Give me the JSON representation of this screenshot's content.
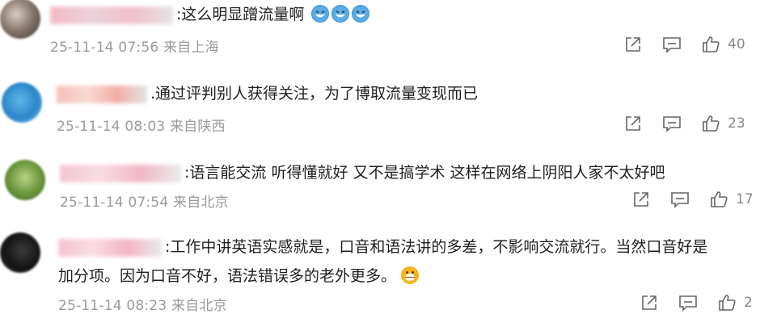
{
  "comments": [
    {
      "text": ":这么明显蹭流量啊",
      "emoji_count": 3,
      "time": "25-11-14 07:56",
      "location": "来自上海",
      "likes": "40"
    },
    {
      "text": ".通过评判别人获得关注，为了博取流量变现而已",
      "time": "25-11-14 08:03",
      "location": "来自陕西",
      "likes": "23"
    },
    {
      "text": ":语言能交流 听得懂就好 又不是搞学术 这样在网络上阴阳人家不太好吧",
      "time": "25-11-14 07:54",
      "location": "来自北京",
      "likes": "17"
    },
    {
      "text": ":工作中讲英语实感就是，口音和语法讲的多差，不影响交流就行。当然口音好是",
      "text_line2": "加分项。因为口音不好，语法错误多的老外更多。",
      "time": "25-11-14 08:23",
      "location": "来自北京",
      "likes": "2"
    }
  ],
  "icons": {
    "share": "share-icon",
    "comment": "comment-icon",
    "like": "like-icon"
  },
  "colors": {
    "meta_text": "#9a9a9a",
    "emoji_blue": "#3b8fd4",
    "emoji_yellow": "#f6b51d"
  }
}
